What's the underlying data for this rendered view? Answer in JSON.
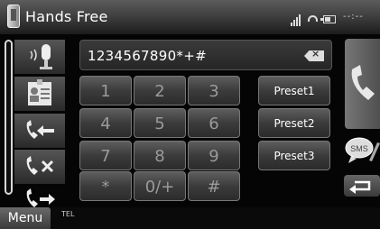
{
  "header": {
    "title": "Hands Free",
    "clock": "--:--",
    "icons": [
      "phone-glyph-icon",
      "signal-icon",
      "handset-icon",
      "battery-icon"
    ]
  },
  "number_field": {
    "value": "1234567890*+#",
    "backspace_icon": "backspace-icon"
  },
  "keypad": {
    "keys": [
      "1",
      "2",
      "3",
      "4",
      "5",
      "6",
      "7",
      "8",
      "9",
      "*",
      "0/+",
      "#"
    ]
  },
  "presets": [
    "Preset1",
    "Preset2",
    "Preset3"
  ],
  "sidebar": {
    "buttons": [
      {
        "icon": "voice-dial-icon"
      },
      {
        "icon": "phonebook-icon"
      },
      {
        "icon": "outgoing-calls-icon"
      },
      {
        "icon": "missed-calls-icon"
      },
      {
        "icon": "incoming-calls-icon"
      }
    ]
  },
  "right": {
    "call_icon": "call-icon",
    "sms_label": "SMS",
    "back_icon": "return-icon"
  },
  "bottom": {
    "menu_label": "Menu",
    "source_label": "TEL"
  },
  "colors": {
    "text": "#ffffff",
    "key_text": "#9a9a9a",
    "accent_gray": "#5e5e5e"
  }
}
